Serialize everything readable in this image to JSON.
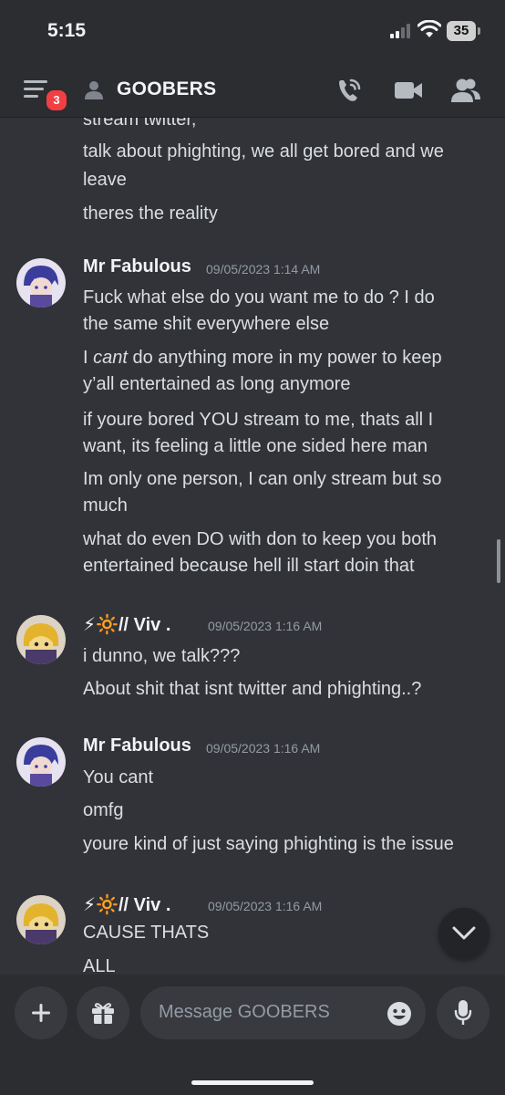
{
  "status_bar": {
    "time": "5:15",
    "battery": "35"
  },
  "header": {
    "menu_badge": "3",
    "channel_name": "GOOBERS"
  },
  "messages": {
    "partial_line": "stream twitter,",
    "group0": {
      "lines": [
        "talk about phighting, we all get bored and we",
        "leave",
        "theres the reality"
      ]
    },
    "group1": {
      "author": "Mr Fabulous",
      "timestamp": "09/05/2023 1:14 AM",
      "lines": [
        "Fuck what else do you want me to do ? I do",
        "the same shit everywhere else",
        "do anything more in my power to keep",
        "y’all entertained as long anymore",
        "if youre bored YOU stream to me, thats all I",
        "want, its feeling a little one sided here man",
        "Im only one person, I can only stream but so",
        "much",
        "what do even DO with don to keep you both",
        "entertained because hell ill start doin that"
      ],
      "line_prefix": "I ",
      "italic_word": "cant"
    },
    "group2": {
      "author": "⚡🔆// Viv .",
      "timestamp": "09/05/2023 1:16 AM",
      "lines": [
        "i dunno, we talk???",
        "About shit that isnt twitter and phighting..?"
      ]
    },
    "group3": {
      "author": "Mr Fabulous",
      "timestamp": "09/05/2023 1:16 AM",
      "lines": [
        "You cant",
        "omfg",
        "youre kind of just saying phighting is the issue"
      ]
    },
    "group4": {
      "author": "⚡🔆// Viv .",
      "timestamp": "09/05/2023 1:16 AM",
      "lines": [
        "CAUSE THATS",
        "ALL"
      ]
    }
  },
  "composer": {
    "placeholder": "Message GOOBERS"
  },
  "icons": {
    "menu": "hamburger-menu-icon",
    "dm": "person-icon",
    "call": "phone-call-icon",
    "video": "video-camera-icon",
    "members": "members-icon",
    "jump": "chevron-down-icon",
    "plus": "plus-icon",
    "gift": "gift-icon",
    "emoji": "emoji-icon",
    "mic": "microphone-icon"
  },
  "colors": {
    "background": "#313338",
    "header": "#2b2d31",
    "badge": "#f23f43",
    "timestamp": "#949ba4",
    "text": "#dbdee1"
  }
}
